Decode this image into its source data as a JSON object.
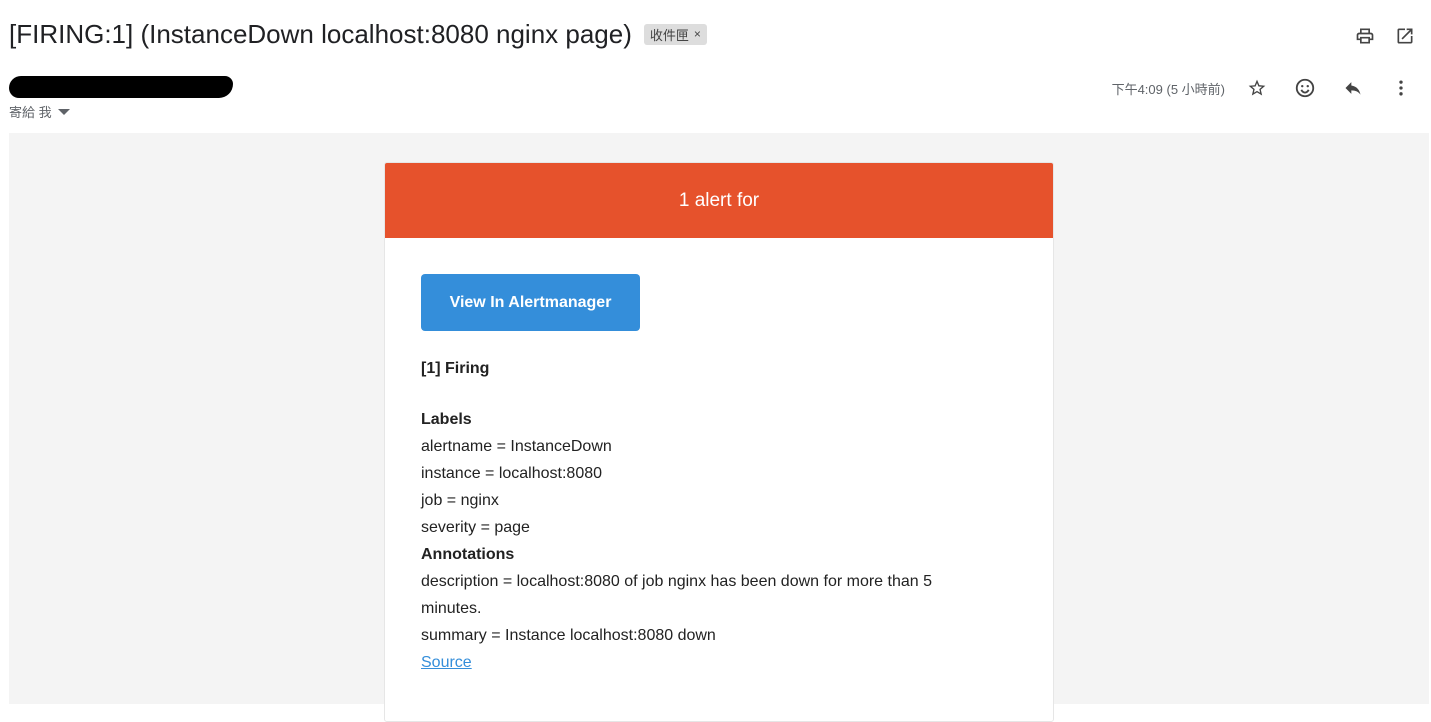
{
  "header": {
    "subject": "[FIRING:1] (InstanceDown localhost:8080 nginx page)",
    "label_chip": "收件匣",
    "label_chip_close": "×",
    "print_icon": "print-icon",
    "open_new_window_icon": "open-in-new-window-icon"
  },
  "sender": {
    "to_line": "寄給 我",
    "time": "下午4:09 (5 小時前)"
  },
  "actions": {
    "star_icon": "star-icon",
    "emoji_icon": "emoji-reaction-icon",
    "reply_icon": "reply-icon",
    "more_icon": "more-vert-icon"
  },
  "email": {
    "header_text": "1 alert for",
    "button_label": "View In Alertmanager",
    "firing_title": "[1] Firing",
    "labels_title": "Labels",
    "labels": [
      "alertname = InstanceDown",
      "instance = localhost:8080",
      "job = nginx",
      "severity = page"
    ],
    "annotations_title": "Annotations",
    "annotation_description_line1": "description = localhost:8080 of job nginx has been down for more than 5",
    "annotation_description_line2": "minutes.",
    "annotation_summary": "summary = Instance localhost:8080 down",
    "source_link": "Source"
  },
  "colors": {
    "header_red": "#e6522c",
    "button_blue": "#348eda",
    "body_bg": "#f4f4f4"
  }
}
